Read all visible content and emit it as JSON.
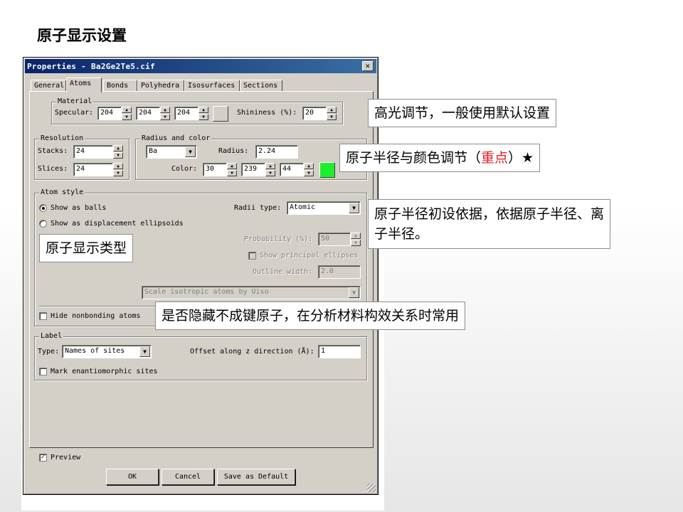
{
  "slide": {
    "title": "原子显示设置"
  },
  "window": {
    "title": "Properties - Ba2Ge2Te5.cif",
    "close_glyph": "✕"
  },
  "tabs": [
    {
      "label": "General"
    },
    {
      "label": "Atoms"
    },
    {
      "label": "Bonds"
    },
    {
      "label": "Polyhedra"
    },
    {
      "label": "Isosurfaces"
    },
    {
      "label": "Sections"
    }
  ],
  "material": {
    "group_label": "Material",
    "specular_label": "Specular:",
    "specular": [
      "204",
      "204",
      "204"
    ],
    "shininess_label": "Shininess (%):",
    "shininess": "20",
    "specular_color": "#d4d0c8"
  },
  "resolution": {
    "group_label": "Resolution",
    "stacks_label": "Stacks:",
    "stacks": "24",
    "slices_label": "Slices:",
    "slices": "24"
  },
  "radius_color": {
    "group_label": "Radius and color",
    "element": "Ba",
    "radius_label": "Radius:",
    "radius": "2.24",
    "color_label": "Color:",
    "color": [
      "30",
      "239",
      "44"
    ],
    "swatch_color": "#1eef2c"
  },
  "atom_style": {
    "group_label": "Atom style",
    "balls_label": "Show as balls",
    "ellipsoids_label": "Show as displacement ellipsoids",
    "radii_type_label": "Radii type:",
    "radii_type": "Atomic",
    "probability_label": "Probability (%):",
    "probability": "50",
    "principal_label": "Show principal ellipses",
    "outline_label": "Outline width:",
    "outline": "2.0",
    "scale_option": "Scale isotropic atoms by Uiso",
    "hide_label": "Hide nonbonding atoms"
  },
  "label": {
    "group_label": "Label",
    "type_label": "Type:",
    "type_value": "Names of sites",
    "offset_label": "Offset along z direction (Å):",
    "offset": "1",
    "mark_label": "Mark enantiomorphic sites"
  },
  "footer": {
    "preview_label": "Preview",
    "ok": "OK",
    "cancel": "Cancel",
    "save_default": "Save as Default"
  },
  "glyphs": {
    "check": "✓",
    "spin_up": "▲",
    "spin_down": "▼",
    "dropdown": "▼"
  },
  "callouts": {
    "specular": "高光调节，一般使用默认设置",
    "radius_prefix": "原子半径与颜色调节（",
    "radius_emph": "重点",
    "radius_suffix": "）★",
    "radii_type_line1": "原子半径初设依据，依据原子半径、离",
    "radii_type_line2": "子半径。",
    "atom_style": "原子显示类型",
    "hide": "是否隐藏不成键原子，在分析材料构效关系时常用"
  }
}
